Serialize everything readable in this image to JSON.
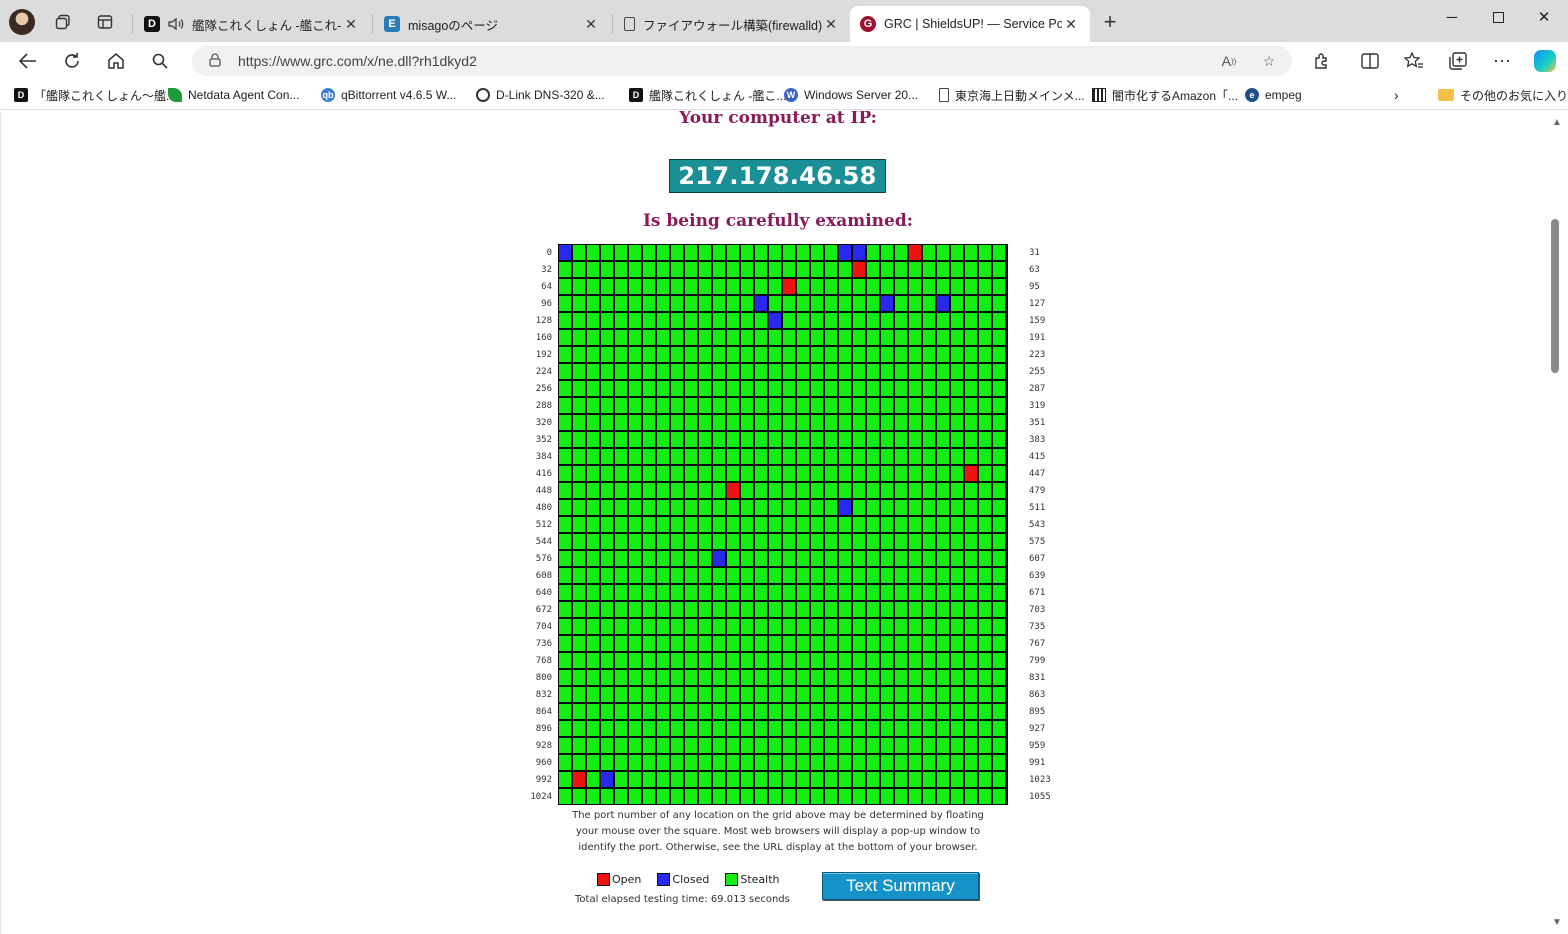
{
  "tabs": [
    {
      "title": "艦隊これくしょん -艦これ- - オン",
      "favicon": "d-icon",
      "audio": true
    },
    {
      "title": "misagoのページ",
      "favicon": "e-icon"
    },
    {
      "title": "ファイアウォール構築(firewalld) - Alm",
      "favicon": "document-icon"
    },
    {
      "title": "GRC | ShieldsUP! — Service Ports",
      "favicon": "grc-icon",
      "active": true
    }
  ],
  "toolbar": {
    "url": "https://www.grc.com/x/ne.dll?rh1dkyd2"
  },
  "bookmarks": [
    {
      "label": "「艦隊これくしょん〜艦...",
      "icon": "d-icon"
    },
    {
      "label": "Netdata Agent Con...",
      "icon": "netdata-icon"
    },
    {
      "label": "qBittorrent v4.6.5 W...",
      "icon": "qbittorrent-icon"
    },
    {
      "label": "D-Link DNS-320 &...",
      "icon": "dlink-icon"
    },
    {
      "label": "艦隊これくしょん -艦こ...",
      "icon": "d-icon"
    },
    {
      "label": "Windows Server 20...",
      "icon": "wordpress-icon"
    },
    {
      "label": "東京海上日動メインメ...",
      "icon": "document-icon"
    },
    {
      "label": "闇市化するAmazon「...",
      "icon": "qr-icon"
    },
    {
      "label": "empeg",
      "icon": "empeg-icon"
    }
  ],
  "bookmarks_other": "その他のお気に入り",
  "page": {
    "heading_top": "Your computer at IP:",
    "ip": "217.178.46.58",
    "heading_examined": "Is being carefully examined:",
    "row_labels_left": [
      "0",
      "32",
      "64",
      "96",
      "128",
      "160",
      "192",
      "224",
      "256",
      "288",
      "320",
      "352",
      "384",
      "416",
      "448",
      "480",
      "512",
      "544",
      "576",
      "608",
      "640",
      "672",
      "704",
      "736",
      "768",
      "800",
      "832",
      "864",
      "896",
      "928",
      "960",
      "992",
      "1024"
    ],
    "row_labels_right": [
      "31",
      "63",
      "95",
      "127",
      "159",
      "191",
      "223",
      "255",
      "287",
      "319",
      "351",
      "383",
      "415",
      "447",
      "479",
      "511",
      "543",
      "575",
      "607",
      "639",
      "671",
      "703",
      "735",
      "767",
      "799",
      "831",
      "863",
      "895",
      "927",
      "959",
      "991",
      "1023",
      "1055"
    ],
    "ports": {
      "open": [
        25,
        53,
        80,
        445,
        460,
        993
      ],
      "closed": [
        0,
        20,
        21,
        110,
        119,
        123,
        143,
        500,
        587,
        995
      ]
    },
    "colors": {
      "open": "#ee1212",
      "closed": "#2828ee",
      "stealth": "#12ee12"
    },
    "note_lines": [
      "The port number of any location on the grid above may be determined by floating",
      "your mouse over the square. Most web browsers will display a pop-up window to",
      "identify the port. Otherwise, see the URL display at the bottom of your browser."
    ],
    "legend": {
      "open": "Open",
      "closed": "Closed",
      "stealth": "Stealth"
    },
    "summary_button": "Text Summary",
    "elapsed": "Total elapsed testing time: 69.013 seconds"
  }
}
